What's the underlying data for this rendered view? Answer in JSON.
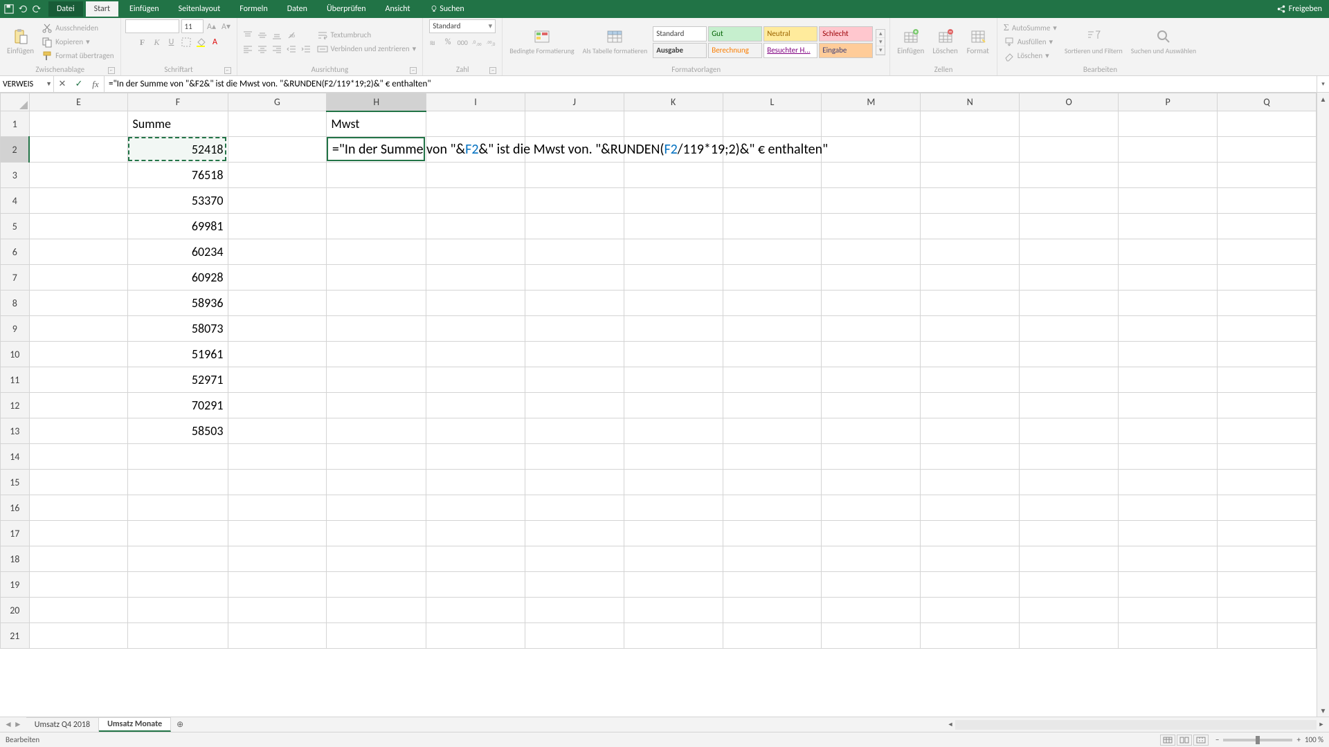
{
  "titlebar": {
    "tabs": [
      "Datei",
      "Start",
      "Einfügen",
      "Seitenlayout",
      "Formeln",
      "Daten",
      "Überprüfen",
      "Ansicht"
    ],
    "active_tab": 1,
    "search_placeholder": "Suchen",
    "share": "Freigeben"
  },
  "ribbon": {
    "clipboard": {
      "paste": "Einfügen",
      "cut": "Ausschneiden",
      "copy": "Kopieren",
      "format_painter": "Format übertragen",
      "group": "Zwischenablage"
    },
    "font": {
      "name": "",
      "size": "11",
      "group": "Schriftart"
    },
    "alignment": {
      "wrap": "Textumbruch",
      "merge": "Verbinden und zentrieren",
      "group": "Ausrichtung"
    },
    "number": {
      "format": "Standard",
      "group": "Zahl"
    },
    "styles": {
      "cond": "Bedingte Formatierung",
      "table": "Als Tabelle formatieren",
      "gallery": [
        "Standard",
        "Gut",
        "Neutral",
        "Schlecht",
        "Ausgabe",
        "Berechnung",
        "Besuchter H...",
        "Eingabe"
      ],
      "group": "Formatvorlagen"
    },
    "cells": {
      "insert": "Einfügen",
      "delete": "Löschen",
      "format": "Format",
      "group": "Zellen"
    },
    "editing": {
      "autosum": "AutoSumme",
      "fill": "Ausfüllen",
      "clear": "Löschen",
      "sort": "Sortieren und Filtern",
      "find": "Suchen und Auswählen",
      "group": "Bearbeiten"
    }
  },
  "formula_bar": {
    "name_box": "VERWEIS",
    "formula_raw": "=\"In der Summe von \"&F2&\" ist die Mwst von. \"&RUNDEN(F2/119*19;2)&\" € enthalten\"",
    "segments": [
      {
        "t": "=\"In der Summe von \"&"
      },
      {
        "t": "F2",
        "ref": true
      },
      {
        "t": "&\" ist die Mwst von. \"&RUNDEN("
      },
      {
        "t": "F2",
        "ref": true
      },
      {
        "t": "/119*19;2)&\" € enthalten\""
      }
    ]
  },
  "sheet": {
    "columns": [
      "E",
      "F",
      "G",
      "H",
      "I",
      "J",
      "K",
      "L",
      "M",
      "N",
      "O",
      "P",
      "Q"
    ],
    "active_col": "H",
    "active_row": 2,
    "ref_cell": {
      "col": "F",
      "row": 2
    },
    "row_count": 21,
    "headers": {
      "F": "Summe",
      "H": "Mwst"
    },
    "data_F": [
      "52418",
      "76518",
      "53370",
      "69981",
      "60234",
      "60928",
      "58936",
      "58073",
      "51961",
      "52971",
      "70291",
      "58503"
    ]
  },
  "tabs": {
    "sheets": [
      "Umsatz Q4 2018",
      "Umsatz Monate"
    ],
    "active": 1
  },
  "statusbar": {
    "mode": "Bearbeiten",
    "zoom": "100 %"
  },
  "chart_data": null
}
